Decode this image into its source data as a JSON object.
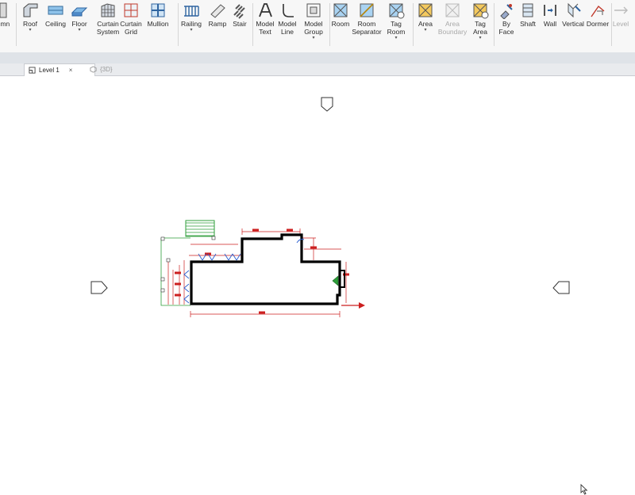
{
  "ribbon": {
    "tools": [
      {
        "id": "column",
        "label": "umn",
        "icon": "column-icon",
        "dropdown": false
      },
      {
        "id": "roof",
        "label": "Roof",
        "icon": "roof-icon",
        "dropdown": true
      },
      {
        "id": "ceiling",
        "label": "Ceiling",
        "icon": "ceiling-icon",
        "dropdown": false
      },
      {
        "id": "floor",
        "label": "Floor",
        "icon": "floor-icon",
        "dropdown": true
      },
      {
        "id": "curtain-system",
        "label": "Curtain\nSystem",
        "icon": "curtain-system-icon",
        "dropdown": false
      },
      {
        "id": "curtain-grid",
        "label": "Curtain\nGrid",
        "icon": "curtain-grid-icon",
        "dropdown": false
      },
      {
        "id": "mullion",
        "label": "Mullion",
        "icon": "mullion-icon",
        "dropdown": false
      },
      {
        "id": "railing",
        "label": "Railing",
        "icon": "railing-icon",
        "dropdown": true
      },
      {
        "id": "ramp",
        "label": "Ramp",
        "icon": "ramp-icon",
        "dropdown": false
      },
      {
        "id": "stair",
        "label": "Stair",
        "icon": "stair-icon",
        "dropdown": false
      },
      {
        "id": "model-text",
        "label": "Model\nText",
        "icon": "model-text-icon",
        "dropdown": false
      },
      {
        "id": "model-line",
        "label": "Model\nLine",
        "icon": "model-line-icon",
        "dropdown": false
      },
      {
        "id": "model-group",
        "label": "Model\nGroup",
        "icon": "model-group-icon",
        "dropdown": true
      },
      {
        "id": "room",
        "label": "Room",
        "icon": "room-icon",
        "dropdown": false
      },
      {
        "id": "room-separator",
        "label": "Room\nSeparator",
        "icon": "room-separator-icon",
        "dropdown": false
      },
      {
        "id": "tag-room",
        "label": "Tag\nRoom",
        "icon": "tag-room-icon",
        "dropdown": true
      },
      {
        "id": "area",
        "label": "Area",
        "icon": "area-icon",
        "dropdown": true
      },
      {
        "id": "area-boundary",
        "label": "Area\nBoundary",
        "icon": "area-boundary-icon",
        "dropdown": false,
        "disabled": true
      },
      {
        "id": "tag-area",
        "label": "Tag\nArea",
        "icon": "tag-area-icon",
        "dropdown": true
      },
      {
        "id": "by-face",
        "label": "By\nFace",
        "icon": "by-face-icon",
        "dropdown": false
      },
      {
        "id": "shaft",
        "label": "Shaft",
        "icon": "shaft-icon",
        "dropdown": false
      },
      {
        "id": "wall",
        "label": "Wall",
        "icon": "wall-opening-icon",
        "dropdown": false
      },
      {
        "id": "vertical",
        "label": "Vertical",
        "icon": "vertical-icon",
        "dropdown": false
      },
      {
        "id": "dormer",
        "label": "Dormer",
        "icon": "dormer-icon",
        "dropdown": false
      },
      {
        "id": "level",
        "label": "Level",
        "icon": "level-icon",
        "dropdown": false,
        "disabled": true
      }
    ]
  },
  "tabs": [
    {
      "label": "Level 1",
      "icon": "floor-plan-icon",
      "active": true,
      "close": "×"
    },
    {
      "label": "{3D}",
      "icon": "3d-view-icon",
      "active": false
    }
  ],
  "canvas": {
    "elevation_markers": [
      "elevation-marker-north",
      "elevation-marker-west",
      "elevation-marker-east"
    ],
    "colors": {
      "wall": "#000000",
      "dimension": "#cc1f1f",
      "green": "#2e9e3a",
      "door": "#2a5fd0"
    }
  }
}
